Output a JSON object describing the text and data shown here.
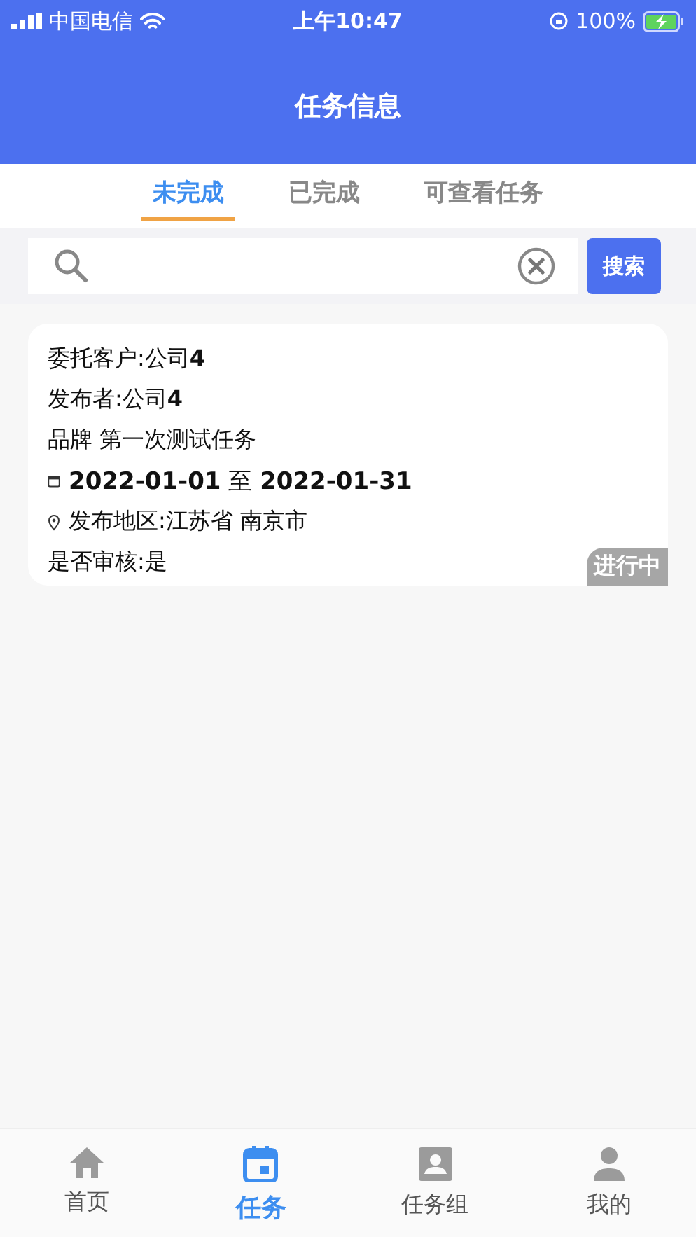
{
  "status_bar": {
    "carrier": "中国电信",
    "time": "上午10:47",
    "battery": "100%"
  },
  "header": {
    "title": "任务信息"
  },
  "tabs": [
    {
      "label": "未完成",
      "selected": true
    },
    {
      "label": "已完成",
      "selected": false
    },
    {
      "label": "可查看任务",
      "selected": false
    }
  ],
  "search": {
    "button": "搜索"
  },
  "tasks": [
    {
      "lines": [
        {
          "kind": "text",
          "text": "委托客户:公司**4**"
        },
        {
          "kind": "text",
          "text": "发布者:公司**4**"
        },
        {
          "kind": "text",
          "text": "品牌 第一次测试任务"
        },
        {
          "kind": "date",
          "text": "**2022-01-01** 至 **2022-01-31**"
        },
        {
          "kind": "location",
          "text": "发布地区:江苏省 南京市"
        },
        {
          "kind": "text",
          "text": "是否审核:是"
        }
      ],
      "status": "进行中"
    }
  ],
  "bottom_nav": [
    {
      "kind": "home",
      "label": "首页",
      "selected": false
    },
    {
      "kind": "calendar",
      "label": "任务",
      "selected": true
    },
    {
      "kind": "portrait",
      "label": "任务组",
      "selected": false
    },
    {
      "kind": "person",
      "label": "我的",
      "selected": false
    }
  ]
}
